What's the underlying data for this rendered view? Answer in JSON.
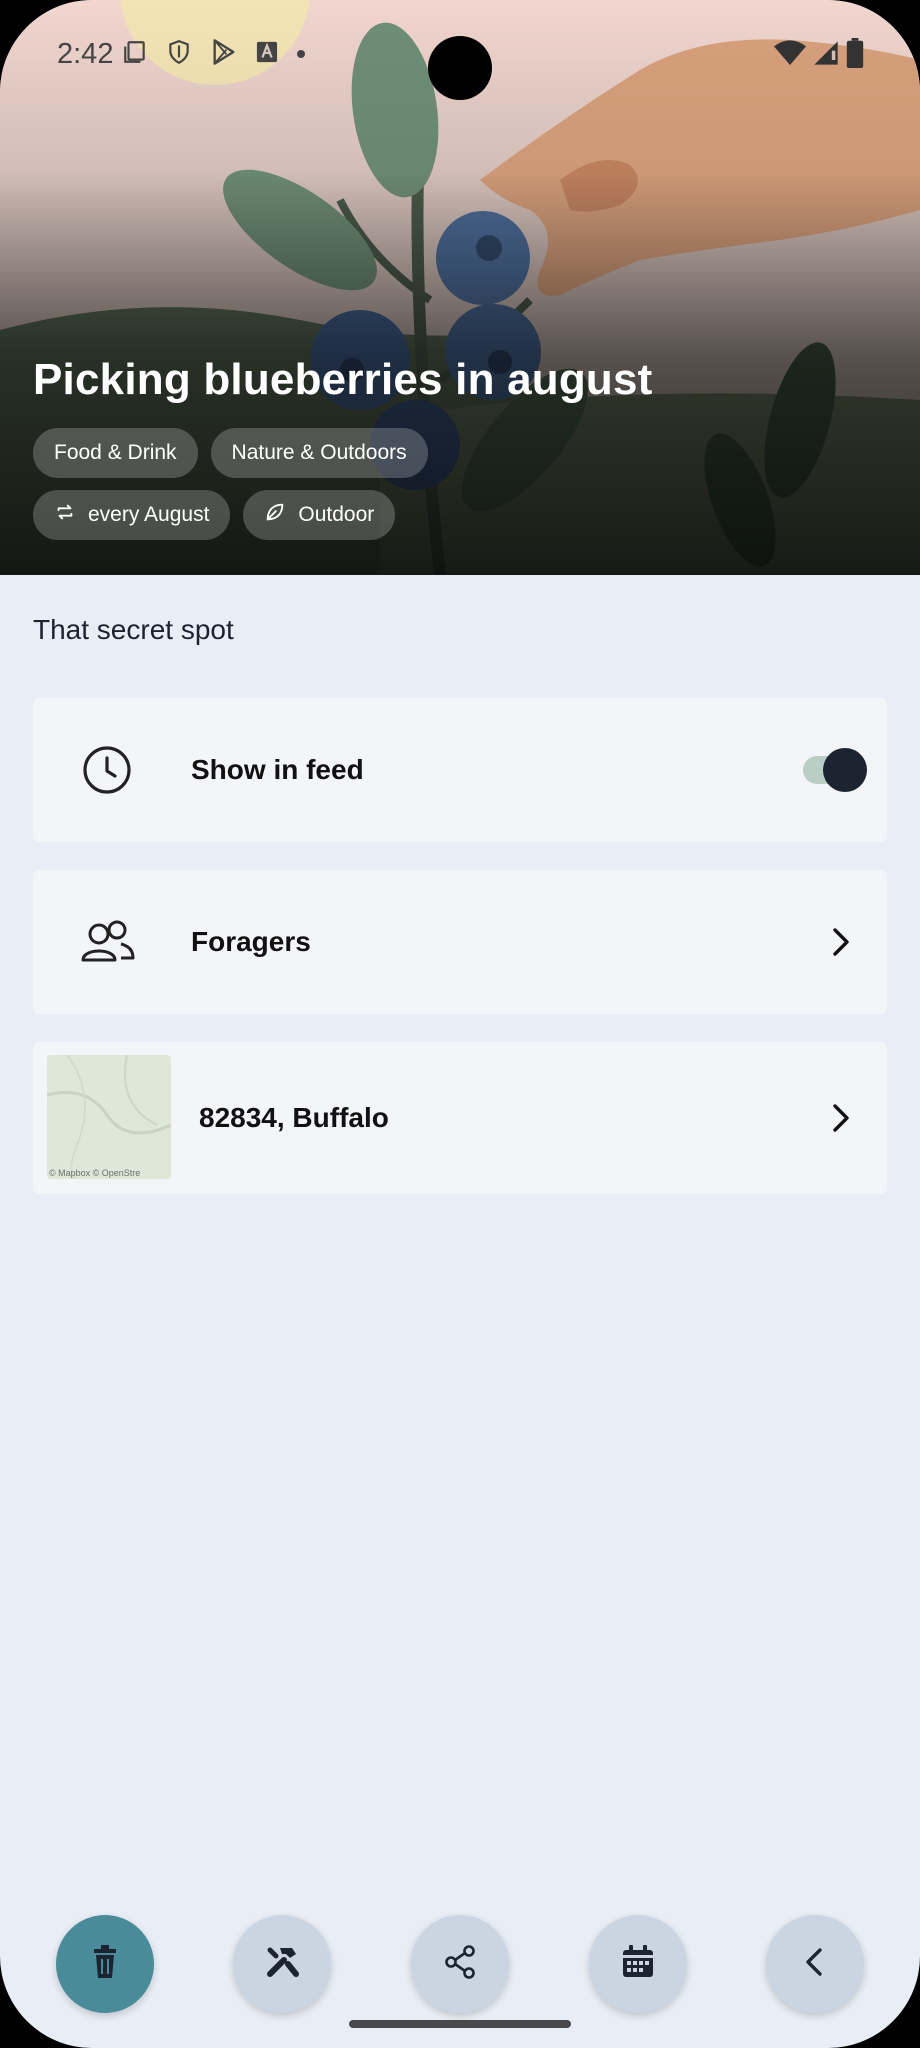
{
  "status_bar": {
    "time": "2:42",
    "left_icons": [
      "screenshot-icon",
      "shield-icon",
      "play-store-icon",
      "text-icon",
      "dot-icon"
    ],
    "right_icons": [
      "wifi-icon",
      "signal-icon",
      "battery-icon"
    ]
  },
  "hero": {
    "title": "Picking blueberries in august",
    "categories": [
      "Food & Drink",
      "Nature & Outdoors"
    ],
    "recurrence": "every August",
    "setting": "Outdoor"
  },
  "description": "That secret spot",
  "cards": {
    "feed": {
      "label": "Show in feed",
      "icon": "clock-icon",
      "enabled": true
    },
    "people": {
      "label": "Foragers",
      "icon": "people-icon"
    },
    "location": {
      "label": "82834, Buffalo",
      "map_credit": "© Mapbox © OpenStre"
    }
  },
  "actions": [
    "trash-icon",
    "tools-icon",
    "share-icon",
    "calendar-icon",
    "back-icon"
  ],
  "colors": {
    "background": "#e9eef6",
    "card": "#f3f5f9",
    "primary_action": "#4a8b9a",
    "secondary_action": "#cbd5e1",
    "toggle_thumb": "#1c2432",
    "toggle_track": "#b9cec5"
  }
}
